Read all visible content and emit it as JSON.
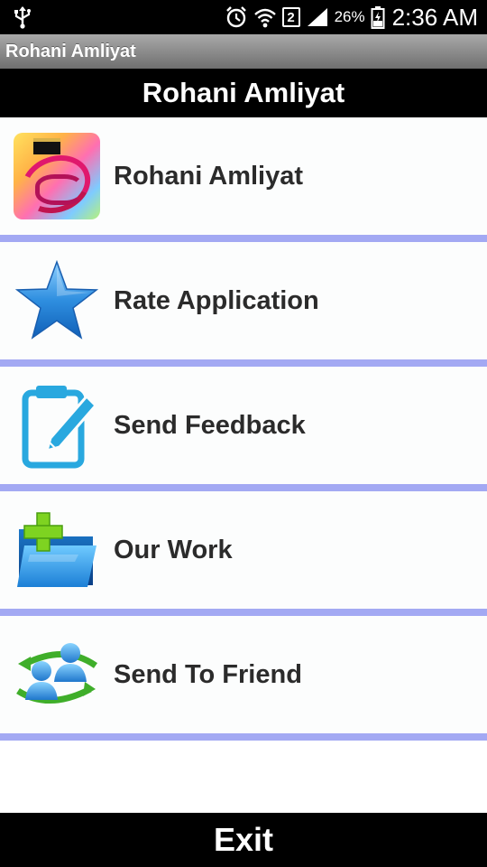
{
  "status_bar": {
    "battery_pct": "26%",
    "time": "2:36 AM",
    "sim_slot": "2",
    "icons": [
      "usb-icon",
      "alarm-icon",
      "wifi-icon",
      "sim-icon",
      "signal-icon",
      "battery-icon"
    ]
  },
  "app_titlebar": {
    "title": "Rohani Amliyat"
  },
  "header": {
    "title": "Rohani Amliyat"
  },
  "menu": {
    "items": [
      {
        "label": "Rohani Amliyat",
        "icon": "app-logo-icon"
      },
      {
        "label": "Rate Application",
        "icon": "star-icon"
      },
      {
        "label": "Send Feedback",
        "icon": "edit-note-icon"
      },
      {
        "label": "Our Work",
        "icon": "folder-add-icon"
      },
      {
        "label": "Send To Friend",
        "icon": "share-users-icon"
      }
    ]
  },
  "footer": {
    "exit_label": "Exit"
  },
  "colors": {
    "divider": "#a3a9f3",
    "header_bg": "#000000",
    "titlebar_bg": "#8a8a8a",
    "item_bg": "#fcfdfd",
    "label": "#2b2b2b"
  }
}
